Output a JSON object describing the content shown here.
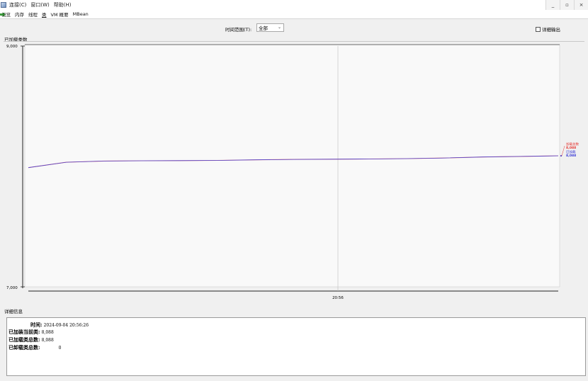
{
  "menubar": {
    "items": [
      "连接(C)",
      "窗口(W)",
      "帮助(H)"
    ]
  },
  "window_controls": [
    "_",
    "▫",
    "×"
  ],
  "tabs": [
    "概览",
    "内存",
    "线程",
    "类",
    "VM 概要",
    "MBean"
  ],
  "active_tab_index": 3,
  "toolbar": {
    "time_range_label": "时间范围(T):",
    "time_range_value": "全部",
    "verbose_output_label": "详细输出",
    "verbose_output_checked": false
  },
  "chart_title": "已加载类数",
  "chart_data": {
    "type": "line",
    "ylim": [
      7000,
      9000
    ],
    "yticks": [
      "9,000",
      "7,000"
    ],
    "xtick": "20:56",
    "series": [
      {
        "name": "加载总数",
        "color": "#e53935",
        "values": [
          7990,
          8035,
          8045,
          8047,
          8048,
          8050,
          8055,
          8058,
          8060,
          8062,
          8065,
          8070,
          8078,
          8083,
          8088
        ]
      },
      {
        "name": "已加载",
        "color": "#3b3bd6",
        "values": [
          7990,
          8035,
          8045,
          8047,
          8048,
          8050,
          8055,
          8058,
          8060,
          8062,
          8065,
          8070,
          8078,
          8083,
          8088
        ]
      }
    ],
    "legend": [
      {
        "label": "加载总数",
        "value": "8,088",
        "color": "#e53935"
      },
      {
        "label": "已加载",
        "value": "8,088",
        "color": "#3b3bd6"
      }
    ],
    "legend_position": "right"
  },
  "details": {
    "title": "详细信息",
    "rows": [
      {
        "label": "时间:",
        "value": "2024-09-04 20:56:26"
      },
      {
        "label": "已加装当前类:",
        "value": "8,088"
      },
      {
        "label": "已加载类总数:",
        "value": "8,088"
      },
      {
        "label": "已卸载类总数:",
        "value": "0"
      }
    ]
  }
}
